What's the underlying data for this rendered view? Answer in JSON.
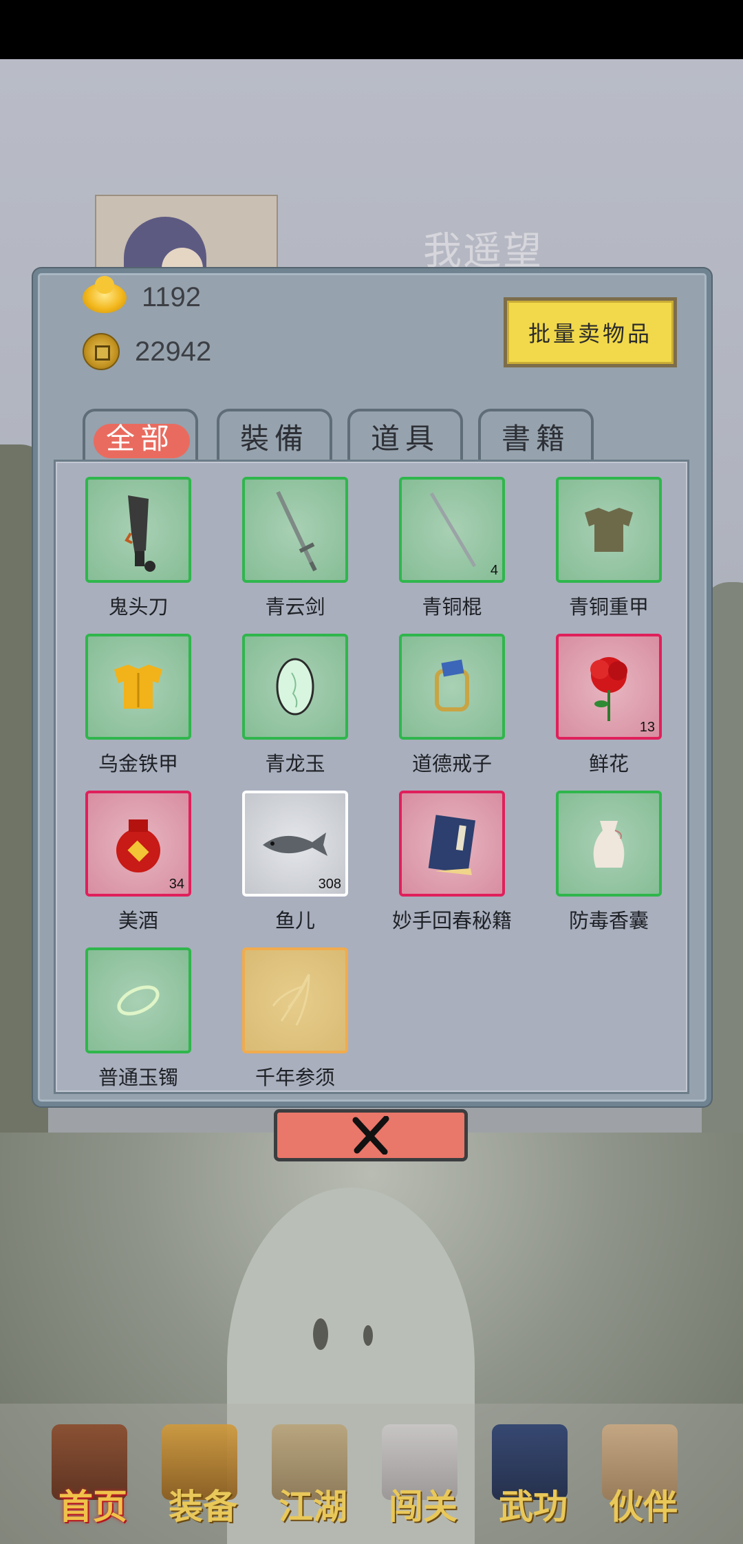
{
  "scene": {
    "title": "我遥望"
  },
  "currency": {
    "gold": "1192",
    "coins": "22942"
  },
  "sell_button": "批量卖物品",
  "tabs": [
    "全部",
    "裝備",
    "道具",
    "書籍"
  ],
  "items": [
    {
      "name": "鬼头刀",
      "count": "",
      "rarity": "green",
      "icon": "broadsword-icon"
    },
    {
      "name": "青云剑",
      "count": "",
      "rarity": "green",
      "icon": "sword-icon"
    },
    {
      "name": "青铜棍",
      "count": "4",
      "rarity": "green",
      "icon": "staff-icon"
    },
    {
      "name": "青铜重甲",
      "count": "",
      "rarity": "green",
      "icon": "armor-icon"
    },
    {
      "name": "乌金铁甲",
      "count": "",
      "rarity": "green",
      "icon": "golden-armor-icon"
    },
    {
      "name": "青龙玉",
      "count": "",
      "rarity": "green",
      "icon": "jade-icon"
    },
    {
      "name": "道德戒子",
      "count": "",
      "rarity": "green",
      "icon": "ring-icon"
    },
    {
      "name": "鲜花",
      "count": "13",
      "rarity": "red",
      "icon": "rose-icon"
    },
    {
      "name": "美酒",
      "count": "34",
      "rarity": "red",
      "icon": "wine-jar-icon"
    },
    {
      "name": "鱼儿",
      "count": "308",
      "rarity": "white",
      "icon": "fish-icon"
    },
    {
      "name": "妙手回春秘籍",
      "count": "",
      "rarity": "red",
      "icon": "book-icon"
    },
    {
      "name": "防毒香囊",
      "count": "",
      "rarity": "green",
      "icon": "sachet-icon"
    },
    {
      "name": "普通玉镯",
      "count": "",
      "rarity": "green",
      "icon": "bracelet-icon"
    },
    {
      "name": "千年参须",
      "count": "",
      "rarity": "orange",
      "icon": "ginseng-icon"
    }
  ],
  "nav": [
    {
      "label": "首页",
      "icon": "home-icon"
    },
    {
      "label": "装备",
      "icon": "equipment-icon"
    },
    {
      "label": "江湖",
      "icon": "map-scroll-icon"
    },
    {
      "label": "闯关",
      "icon": "swords-icon"
    },
    {
      "label": "武功",
      "icon": "martial-book-icon"
    },
    {
      "label": "伙伴",
      "icon": "partners-icon"
    }
  ],
  "colors": {
    "rarity_green": "#2fb64c",
    "rarity_red": "#e01f5b",
    "rarity_white": "#ffffff",
    "rarity_orange": "#f1ab4d",
    "close_button": "#e9776a",
    "sell_button": "#f1d94b"
  }
}
